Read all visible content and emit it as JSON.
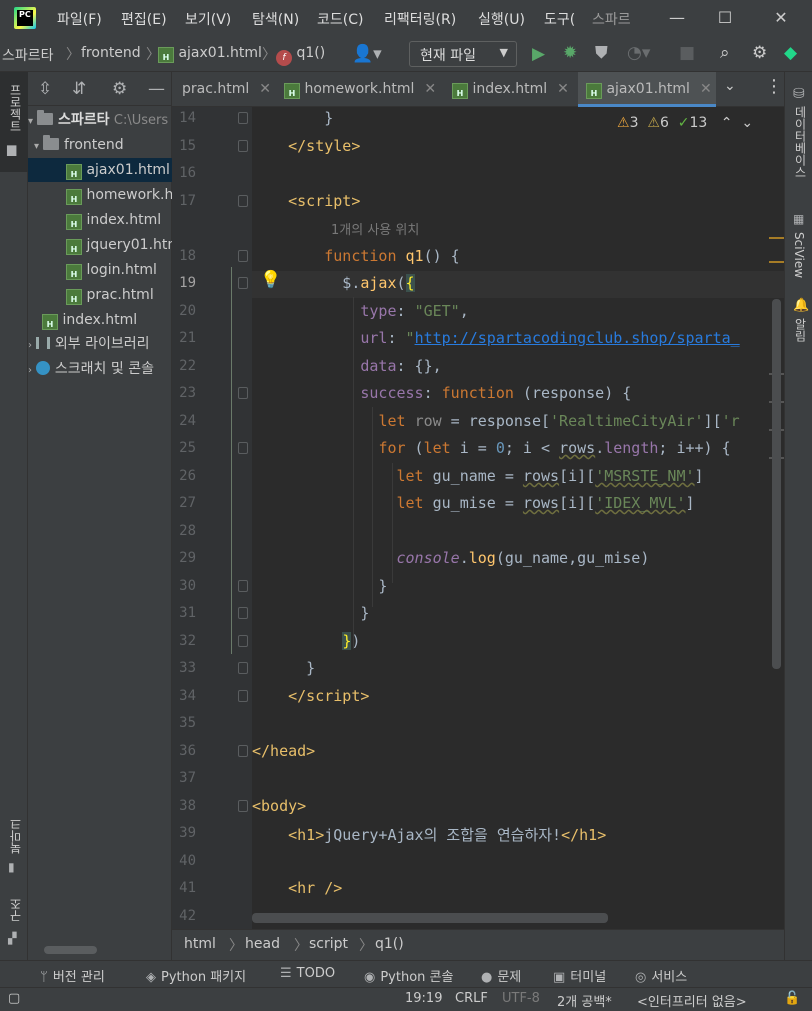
{
  "menubar": {
    "items": [
      "파일(F)",
      "편집(E)",
      "보기(V)",
      "탐색(N)",
      "코드(C)",
      "리팩터링(R)",
      "실행(U)",
      "도구("
    ],
    "window_title": "스파르",
    "logo_text": "PC",
    "minimize": "—",
    "maximize": "☐",
    "close": "✕"
  },
  "navbar": {
    "project": "스파르타",
    "folder": "frontend",
    "file": "ajax01.html",
    "function": "q1()",
    "run_config": "현재 파일",
    "html_icon": "H",
    "fn_icon": "f"
  },
  "left_strip": {
    "project_label": "프로젝트",
    "bookmarks_label": "북마크",
    "structure_label": "구조"
  },
  "right_strip": {
    "database_label": "데이터베이스",
    "sciview_label": "SciView",
    "notifications_label": "알림"
  },
  "project_tree": {
    "root": "스파르타",
    "root_path": "C:\\Users",
    "folder": "frontend",
    "files": [
      "ajax01.html",
      "homework.html",
      "index.html",
      "jquery01.html",
      "login.html",
      "prac.html"
    ],
    "root_file": "index.html",
    "external_libs": "외부 라이브러리",
    "scratches": "스크래치 및 콘솔"
  },
  "tabs": [
    "prac.html",
    "homework.html",
    "index.html",
    "ajax01.html"
  ],
  "inspections": {
    "warnings": "3",
    "weak_warnings": "6",
    "ok": "13"
  },
  "editor": {
    "line_numbers": [
      "14",
      "15",
      "16",
      "17",
      "18",
      "19",
      "20",
      "21",
      "22",
      "23",
      "24",
      "25",
      "26",
      "27",
      "28",
      "29",
      "30",
      "31",
      "32",
      "33",
      "34",
      "35",
      "36",
      "37",
      "38",
      "39",
      "40",
      "41",
      "42"
    ],
    "current_line": "19",
    "usage_hint": "1개의 사용 위치",
    "h1_text": "jQuery+Ajax의 조합을 연습하자!",
    "url": "http://spartacodingclub.shop/sparta_"
  },
  "editor_breadcrumb": [
    "html",
    "head",
    "script",
    "q1()"
  ],
  "tool_windows": [
    "버전 관리",
    "Python 패키지",
    "TODO",
    "Python 콘솔",
    "문제",
    "터미널",
    "서비스"
  ],
  "statusbar": {
    "position": "19:19",
    "line_sep": "CRLF",
    "encoding": "UTF-8",
    "indent": "2개 공백*",
    "interpreter": "<인터프리터 없음>"
  },
  "colors": {
    "background": "#2b2b2b",
    "panel": "#3c3f41",
    "keyword": "#cc7832",
    "string": "#6a8759",
    "number": "#6897bb",
    "function": "#ffc66d",
    "tag": "#e8bf6a",
    "selection": "#0d293e",
    "active_tab_underline": "#4a88c7"
  }
}
